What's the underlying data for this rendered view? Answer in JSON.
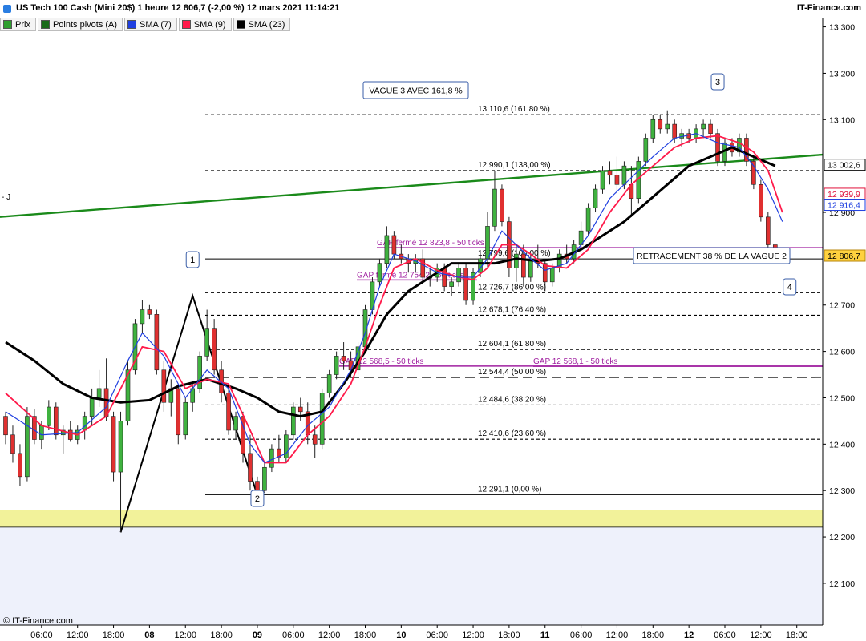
{
  "header": {
    "title": "US Tech 100 Cash (Mini 20$) 1 heure 12 806,7 (-2,00 %) 12 mars 2021 11:14:21",
    "brand": "IT-Finance.com",
    "copyright": "© IT-Finance.com"
  },
  "legend": [
    {
      "label": "Prix",
      "color": "#2e9e2e"
    },
    {
      "label": "Points pivots (A)",
      "color": "#1a6a1a"
    },
    {
      "label": "SMA (7)",
      "color": "#1f3fe0"
    },
    {
      "label": "SMA (9)",
      "color": "#ff1a4a"
    },
    {
      "label": "SMA (23)",
      "color": "#000000"
    }
  ],
  "colors": {
    "up": "#3fb23f",
    "down": "#e03030",
    "sma7": "#1f3fe0",
    "sma9": "#ff1a4a",
    "sma23": "#000000",
    "trendline": "#1a8a1a",
    "gap": "#a020a0",
    "zone": "#f2f29a"
  },
  "chart_data": {
    "type": "candlestick",
    "ylim": [
      12010,
      13320
    ],
    "yticks": [
      {
        "value": 13300,
        "label": "13 300"
      },
      {
        "value": 13200,
        "label": "13 200"
      },
      {
        "value": 13100,
        "label": "13 100"
      },
      {
        "value": 12900,
        "label": "12 900"
      },
      {
        "value": 12700,
        "label": "12 700"
      },
      {
        "value": 12600,
        "label": "12 600"
      },
      {
        "value": 12500,
        "label": "12 500"
      },
      {
        "value": 12400,
        "label": "12 400"
      },
      {
        "value": 12300,
        "label": "12 300"
      },
      {
        "value": 12200,
        "label": "12 200"
      },
      {
        "value": 12100,
        "label": "12 100"
      }
    ],
    "xticks": [
      {
        "i": 5,
        "label": "06:00",
        "bold": false
      },
      {
        "i": 10,
        "label": "12:00",
        "bold": false
      },
      {
        "i": 15,
        "label": "18:00",
        "bold": false
      },
      {
        "i": 20,
        "label": "08",
        "bold": true
      },
      {
        "i": 25,
        "label": "12:00",
        "bold": false
      },
      {
        "i": 30,
        "label": "18:00",
        "bold": false
      },
      {
        "i": 35,
        "label": "09",
        "bold": true
      },
      {
        "i": 40,
        "label": "06:00",
        "bold": false
      },
      {
        "i": 45,
        "label": "12:00",
        "bold": false
      },
      {
        "i": 50,
        "label": "18:00",
        "bold": false
      },
      {
        "i": 55,
        "label": "10",
        "bold": true
      },
      {
        "i": 60,
        "label": "06:00",
        "bold": false
      },
      {
        "i": 65,
        "label": "12:00",
        "bold": false
      },
      {
        "i": 70,
        "label": "18:00",
        "bold": false
      },
      {
        "i": 75,
        "label": "11",
        "bold": true
      },
      {
        "i": 80,
        "label": "06:00",
        "bold": false
      },
      {
        "i": 85,
        "label": "12:00",
        "bold": false
      },
      {
        "i": 90,
        "label": "18:00",
        "bold": false
      },
      {
        "i": 95,
        "label": "12",
        "bold": true
      },
      {
        "i": 100,
        "label": "06:00",
        "bold": false
      },
      {
        "i": 105,
        "label": "12:00",
        "bold": false
      },
      {
        "i": 110,
        "label": "18:00",
        "bold": false
      }
    ],
    "candles": [
      [
        12460,
        12470,
        12400,
        12420
      ],
      [
        12420,
        12440,
        12360,
        12380
      ],
      [
        12380,
        12400,
        12310,
        12330
      ],
      [
        12330,
        12480,
        12320,
        12460
      ],
      [
        12460,
        12475,
        12400,
        12410
      ],
      [
        12410,
        12450,
        12390,
        12440
      ],
      [
        12440,
        12495,
        12430,
        12480
      ],
      [
        12480,
        12490,
        12410,
        12420
      ],
      [
        12420,
        12440,
        12380,
        12430
      ],
      [
        12430,
        12450,
        12405,
        12410
      ],
      [
        12410,
        12440,
        12400,
        12430
      ],
      [
        12430,
        12470,
        12410,
        12460
      ],
      [
        12460,
        12520,
        12440,
        12500
      ],
      [
        12500,
        12560,
        12480,
        12520
      ],
      [
        12520,
        12585,
        12450,
        12460
      ],
      [
        12460,
        12470,
        12320,
        12340
      ],
      [
        12340,
        12470,
        12210,
        12450
      ],
      [
        12450,
        12580,
        12440,
        12560
      ],
      [
        12560,
        12670,
        12550,
        12660
      ],
      [
        12660,
        12710,
        12640,
        12690
      ],
      [
        12690,
        12700,
        12670,
        12680
      ],
      [
        12680,
        12690,
        12550,
        12560
      ],
      [
        12560,
        12580,
        12470,
        12490
      ],
      [
        12490,
        12540,
        12460,
        12520
      ],
      [
        12520,
        12530,
        12400,
        12420
      ],
      [
        12420,
        12500,
        12410,
        12490
      ],
      [
        12490,
        12530,
        12470,
        12520
      ],
      [
        12520,
        12600,
        12510,
        12590
      ],
      [
        12590,
        12690,
        12580,
        12650
      ],
      [
        12650,
        12670,
        12550,
        12560
      ],
      [
        12560,
        12580,
        12490,
        12510
      ],
      [
        12510,
        12530,
        12420,
        12430
      ],
      [
        12430,
        12470,
        12410,
        12460
      ],
      [
        12460,
        12470,
        12360,
        12380
      ],
      [
        12380,
        12420,
        12300,
        12320
      ],
      [
        12320,
        12330,
        12290,
        12300
      ],
      [
        12300,
        12360,
        12295,
        12350
      ],
      [
        12350,
        12400,
        12340,
        12390
      ],
      [
        12390,
        12420,
        12360,
        12370
      ],
      [
        12370,
        12430,
        12360,
        12420
      ],
      [
        12420,
        12490,
        12410,
        12480
      ],
      [
        12480,
        12500,
        12450,
        12470
      ],
      [
        12470,
        12490,
        12400,
        12420
      ],
      [
        12420,
        12440,
        12370,
        12400
      ],
      [
        12400,
        12520,
        12390,
        12510
      ],
      [
        12510,
        12560,
        12500,
        12550
      ],
      [
        12550,
        12600,
        12540,
        12590
      ],
      [
        12590,
        12620,
        12560,
        12580
      ],
      [
        12580,
        12600,
        12545,
        12560
      ],
      [
        12560,
        12620,
        12550,
        12610
      ],
      [
        12610,
        12700,
        12600,
        12690
      ],
      [
        12690,
        12760,
        12680,
        12750
      ],
      [
        12750,
        12800,
        12740,
        12790
      ],
      [
        12790,
        12870,
        12780,
        12850
      ],
      [
        12850,
        12860,
        12800,
        12810
      ],
      [
        12810,
        12830,
        12790,
        12800
      ],
      [
        12800,
        12810,
        12770,
        12790
      ],
      [
        12790,
        12810,
        12770,
        12800
      ],
      [
        12800,
        12820,
        12750,
        12760
      ],
      [
        12760,
        12780,
        12740,
        12760
      ],
      [
        12760,
        12790,
        12750,
        12780
      ],
      [
        12780,
        12790,
        12730,
        12740
      ],
      [
        12740,
        12760,
        12720,
        12750
      ],
      [
        12750,
        12790,
        12740,
        12780
      ],
      [
        12780,
        12790,
        12700,
        12710
      ],
      [
        12710,
        12780,
        12700,
        12770
      ],
      [
        12770,
        12810,
        12760,
        12800
      ],
      [
        12800,
        12900,
        12780,
        12870
      ],
      [
        12870,
        12990,
        12860,
        12950
      ],
      [
        12950,
        12960,
        12870,
        12880
      ],
      [
        12880,
        12890,
        12760,
        12780
      ],
      [
        12780,
        12830,
        12750,
        12810
      ],
      [
        12810,
        12830,
        12740,
        12760
      ],
      [
        12760,
        12810,
        12750,
        12800
      ],
      [
        12800,
        12830,
        12780,
        12790
      ],
      [
        12790,
        12800,
        12730,
        12750
      ],
      [
        12750,
        12790,
        12740,
        12780
      ],
      [
        12780,
        12820,
        12770,
        12810
      ],
      [
        12810,
        12830,
        12790,
        12800
      ],
      [
        12800,
        12840,
        12790,
        12830
      ],
      [
        12830,
        12880,
        12820,
        12860
      ],
      [
        12860,
        12920,
        12850,
        12910
      ],
      [
        12910,
        12960,
        12900,
        12950
      ],
      [
        12950,
        13000,
        12940,
        12990
      ],
      [
        12990,
        13010,
        12960,
        12980
      ],
      [
        12980,
        13020,
        12940,
        12960
      ],
      [
        12960,
        13010,
        12950,
        13000
      ],
      [
        12960,
        13000,
        12890,
        12930
      ],
      [
        12930,
        13020,
        12920,
        13010
      ],
      [
        13010,
        13070,
        13000,
        13060
      ],
      [
        13060,
        13110,
        13050,
        13100
      ],
      [
        13100,
        13110,
        13070,
        13080
      ],
      [
        13080,
        13120,
        13070,
        13090
      ],
      [
        13090,
        13100,
        13050,
        13060
      ],
      [
        13060,
        13080,
        13040,
        13070
      ],
      [
        13070,
        13080,
        13050,
        13060
      ],
      [
        13060,
        13090,
        13050,
        13080
      ],
      [
        13080,
        13100,
        13060,
        13090
      ],
      [
        13090,
        13100,
        13060,
        13070
      ],
      [
        13070,
        13080,
        13000,
        13010
      ],
      [
        13010,
        13060,
        13000,
        13050
      ],
      [
        13050,
        13060,
        13020,
        13030
      ],
      [
        13030,
        13070,
        13020,
        13060
      ],
      [
        13060,
        13070,
        13000,
        13010
      ],
      [
        13010,
        13020,
        12950,
        12960
      ],
      [
        12960,
        12970,
        12880,
        12890
      ],
      [
        12890,
        12900,
        12820,
        12830
      ],
      [
        12830,
        12830,
        12800,
        12810
      ],
      [
        12810,
        12820,
        12790,
        12807
      ]
    ],
    "sma7": [
      [
        0,
        12470
      ],
      [
        5,
        12420
      ],
      [
        10,
        12425
      ],
      [
        14,
        12480
      ],
      [
        17,
        12580
      ],
      [
        19,
        12640
      ],
      [
        22,
        12590
      ],
      [
        25,
        12500
      ],
      [
        28,
        12560
      ],
      [
        31,
        12520
      ],
      [
        34,
        12400
      ],
      [
        36,
        12360
      ],
      [
        39,
        12380
      ],
      [
        42,
        12440
      ],
      [
        45,
        12480
      ],
      [
        48,
        12560
      ],
      [
        50,
        12640
      ],
      [
        52,
        12740
      ],
      [
        54,
        12810
      ],
      [
        57,
        12795
      ],
      [
        60,
        12770
      ],
      [
        63,
        12760
      ],
      [
        65,
        12760
      ],
      [
        67,
        12800
      ],
      [
        69,
        12860
      ],
      [
        71,
        12830
      ],
      [
        73,
        12800
      ],
      [
        75,
        12775
      ],
      [
        78,
        12790
      ],
      [
        81,
        12850
      ],
      [
        84,
        12930
      ],
      [
        87,
        12975
      ],
      [
        90,
        13020
      ],
      [
        93,
        13060
      ],
      [
        96,
        13070
      ],
      [
        99,
        13050
      ],
      [
        102,
        13040
      ],
      [
        104,
        13000
      ],
      [
        106,
        12950
      ],
      [
        108,
        12880
      ]
    ],
    "sma9": [
      [
        0,
        12510
      ],
      [
        5,
        12440
      ],
      [
        10,
        12420
      ],
      [
        14,
        12460
      ],
      [
        17,
        12550
      ],
      [
        19,
        12610
      ],
      [
        22,
        12600
      ],
      [
        25,
        12520
      ],
      [
        28,
        12540
      ],
      [
        31,
        12530
      ],
      [
        34,
        12430
      ],
      [
        36,
        12360
      ],
      [
        39,
        12360
      ],
      [
        42,
        12420
      ],
      [
        45,
        12460
      ],
      [
        48,
        12530
      ],
      [
        50,
        12610
      ],
      [
        52,
        12700
      ],
      [
        54,
        12780
      ],
      [
        57,
        12800
      ],
      [
        60,
        12775
      ],
      [
        63,
        12760
      ],
      [
        65,
        12755
      ],
      [
        67,
        12780
      ],
      [
        69,
        12830
      ],
      [
        71,
        12830
      ],
      [
        73,
        12810
      ],
      [
        75,
        12785
      ],
      [
        78,
        12780
      ],
      [
        81,
        12820
      ],
      [
        84,
        12900
      ],
      [
        87,
        12960
      ],
      [
        90,
        13000
      ],
      [
        93,
        13040
      ],
      [
        96,
        13060
      ],
      [
        99,
        13065
      ],
      [
        102,
        13050
      ],
      [
        104,
        13030
      ],
      [
        106,
        12990
      ],
      [
        108,
        12900
      ]
    ],
    "sma23": [
      [
        0,
        12620
      ],
      [
        4,
        12580
      ],
      [
        8,
        12530
      ],
      [
        12,
        12500
      ],
      [
        16,
        12490
      ],
      [
        20,
        12495
      ],
      [
        24,
        12525
      ],
      [
        28,
        12540
      ],
      [
        32,
        12520
      ],
      [
        35,
        12500
      ],
      [
        38,
        12470
      ],
      [
        41,
        12460
      ],
      [
        44,
        12470
      ],
      [
        47,
        12530
      ],
      [
        50,
        12600
      ],
      [
        53,
        12680
      ],
      [
        56,
        12730
      ],
      [
        59,
        12760
      ],
      [
        62,
        12790
      ],
      [
        65,
        12790
      ],
      [
        68,
        12790
      ],
      [
        71,
        12800
      ],
      [
        74,
        12795
      ],
      [
        77,
        12800
      ],
      [
        80,
        12820
      ],
      [
        83,
        12850
      ],
      [
        86,
        12880
      ],
      [
        89,
        12920
      ],
      [
        92,
        12960
      ],
      [
        95,
        13000
      ],
      [
        98,
        13020
      ],
      [
        101,
        13040
      ],
      [
        104,
        13020
      ],
      [
        107,
        13000
      ]
    ],
    "levels": [
      {
        "value": 13110.6,
        "label": "13 110,6 (161,80 %)",
        "style": "dashed"
      },
      {
        "value": 12990.1,
        "label": "12 990,1 (138,00 %)",
        "style": "dashed"
      },
      {
        "value": 12799.6,
        "label": "12 799,6 (100,00 %)",
        "style": "solid"
      },
      {
        "value": 12726.7,
        "label": "12 726,7 (86,00 %)",
        "style": "dashed"
      },
      {
        "value": 12678.1,
        "label": "12 678,1 (76,40 %)",
        "style": "dashed"
      },
      {
        "value": 12604.1,
        "label": "12 604,1 (61,80 %)",
        "style": "dashed"
      },
      {
        "value": 12544.4,
        "label": "12 544,4 (50,00 %)",
        "style": "longdash"
      },
      {
        "value": 12484.6,
        "label": "12 484,6 (38,20 %)",
        "style": "dashed"
      },
      {
        "value": 12410.6,
        "label": "12 410,6 (23,60 %)",
        "style": "dashed"
      },
      {
        "value": 12291.1,
        "label": "12 291,1 (0,00 %)",
        "style": "solid"
      }
    ],
    "gaps": [
      {
        "value": 12823.8,
        "label": "GAP fermé 12 823,8 - 50 ticks"
      },
      {
        "value": 12754.2,
        "label": "GAP fermé 12 754,2 - 50 ticks"
      },
      {
        "value": 12568.5,
        "label": "GAP 12 568,5 - 50 ticks"
      },
      {
        "value": 12568.1,
        "label": "GAP 12 568,1 - 50 ticks"
      }
    ],
    "zone": [
      12221,
      12258
    ],
    "trendline": {
      "from": [
        -1,
        12890
      ],
      "to": [
        115,
        13026
      ]
    },
    "waves": [
      {
        "label": "1",
        "i": 26,
        "value": 12720
      },
      {
        "label": "2",
        "i": 35,
        "value": 12290
      },
      {
        "label": "3",
        "i": 99,
        "value": 13120
      },
      {
        "label": "4",
        "i": 109,
        "value": 12790
      }
    ],
    "wave_path": [
      [
        16,
        12210
      ],
      [
        26,
        12720
      ],
      [
        35,
        12290
      ]
    ],
    "annotations": [
      "VAGUE 3 AVEC 161,8 %",
      "RETRACEMENT 38 % DE LA VAGUE 2"
    ],
    "price_tags": [
      {
        "value": 13002.6,
        "label": "13 002,6",
        "bg": "#ffffff",
        "fg": "#000000",
        "border": "#000000"
      },
      {
        "value": 12939.9,
        "label": "12 939,9",
        "bg": "#ffffff",
        "fg": "#e0103a",
        "border": "#e0103a"
      },
      {
        "value": 12916.4,
        "label": "12 916,4",
        "bg": "#ffffff",
        "fg": "#1f3fe0",
        "border": "#1f3fe0"
      },
      {
        "value": 12806.7,
        "label": "12 806,7",
        "bg": "#ffd23f",
        "fg": "#000000",
        "border": "#b8860b"
      }
    ],
    "left_marker": "- J"
  }
}
